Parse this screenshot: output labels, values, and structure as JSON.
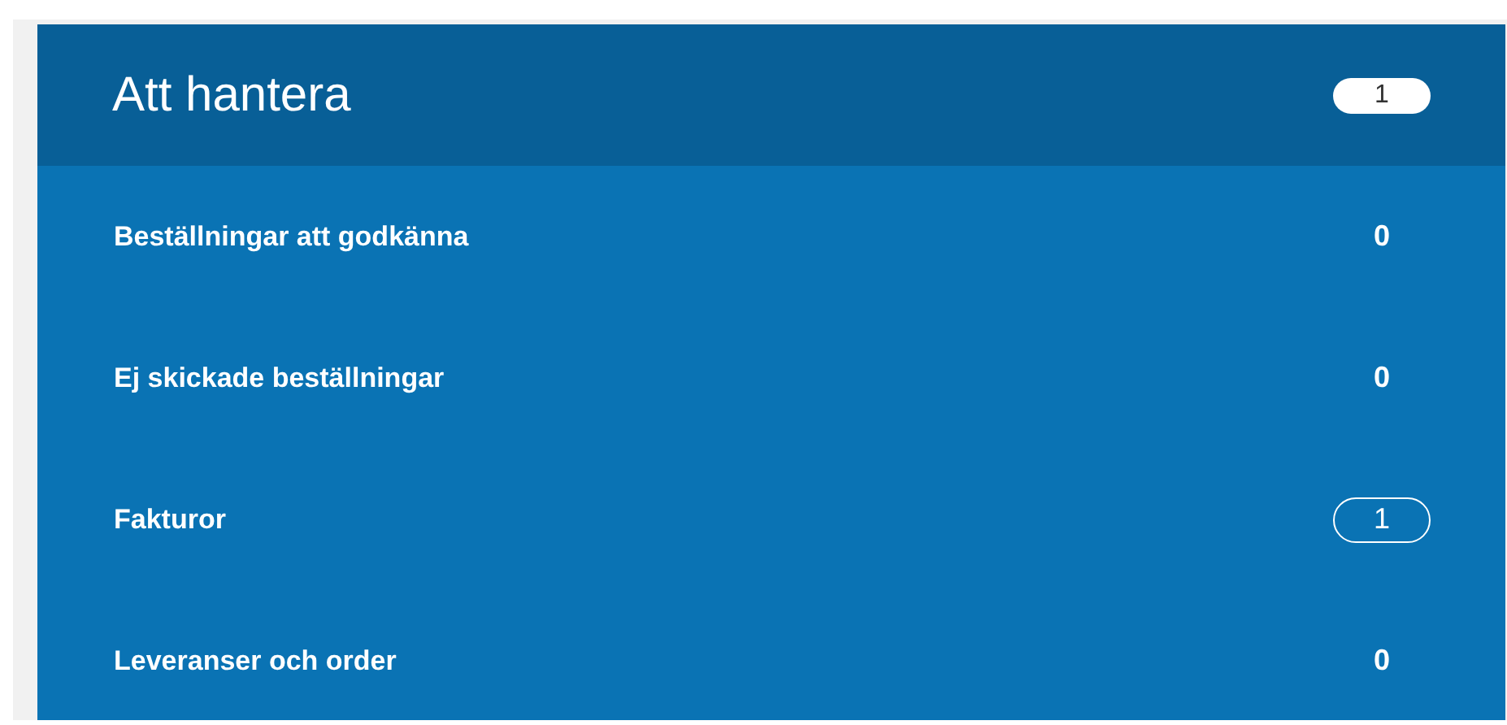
{
  "panel": {
    "title": "Att hantera",
    "badge": "1",
    "items": [
      {
        "label": "Beställningar att godkänna",
        "count": "0",
        "kind": "plain"
      },
      {
        "label": "Ej skickade beställningar",
        "count": "0",
        "kind": "plain"
      },
      {
        "label": "Fakturor",
        "count": "1",
        "kind": "badge"
      },
      {
        "label": "Leveranser och order",
        "count": "0",
        "kind": "plain"
      }
    ]
  }
}
